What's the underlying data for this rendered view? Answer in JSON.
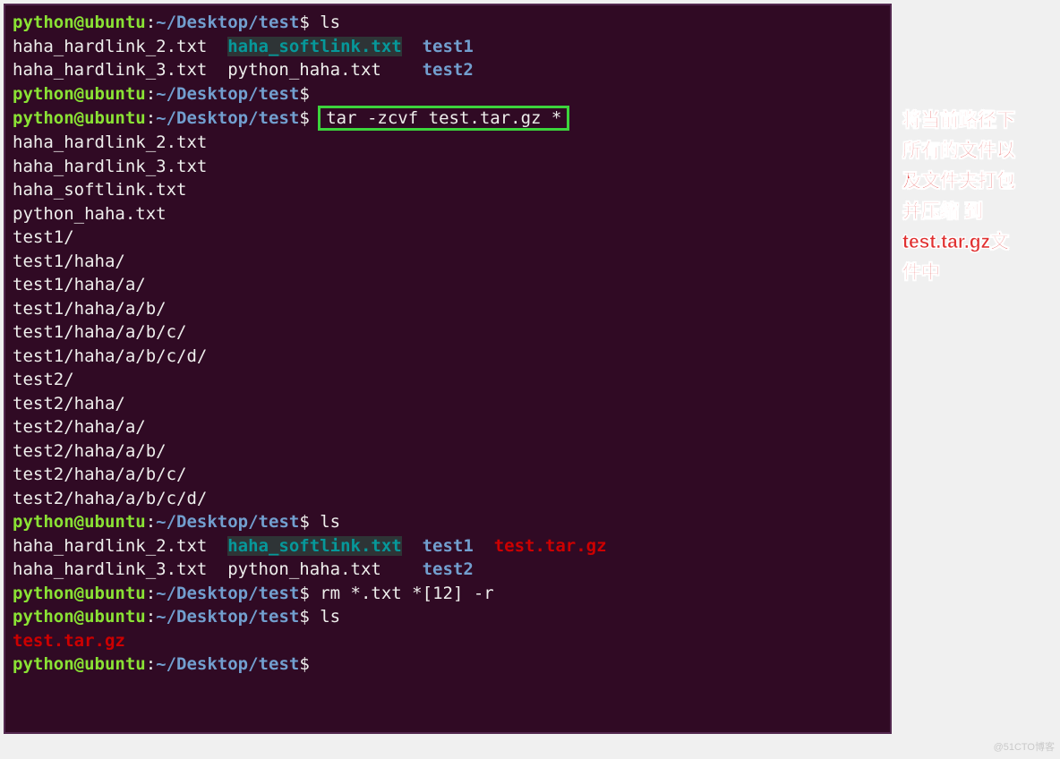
{
  "prompt": {
    "user": "python@ubuntu",
    "sep": ":",
    "path": "~/Desktop/test",
    "dollar": "$"
  },
  "cmd": {
    "ls": "ls",
    "tar": "tar -zcvf test.tar.gz *",
    "rm": "rm *.txt *[12] -r"
  },
  "files": {
    "hardlink2": "haha_hardlink_2.txt",
    "hardlink3": "haha_hardlink_3.txt",
    "softlink": "haha_softlink.txt",
    "pyhaha": "python_haha.txt",
    "test1": "test1",
    "test2": "test2",
    "tgz": "test.tar.gz"
  },
  "tarout": [
    "haha_hardlink_2.txt",
    "haha_hardlink_3.txt",
    "haha_softlink.txt",
    "python_haha.txt",
    "test1/",
    "test1/haha/",
    "test1/haha/a/",
    "test1/haha/a/b/",
    "test1/haha/a/b/c/",
    "test1/haha/a/b/c/d/",
    "test2/",
    "test2/haha/",
    "test2/haha/a/",
    "test2/haha/a/b/",
    "test2/haha/a/b/c/",
    "test2/haha/a/b/c/d/"
  ],
  "annotation": {
    "line1": "将当前路径下",
    "line2": "所有的文件以",
    "line3": "及文件夹打包",
    "line4": "并压缩 到",
    "line5": "test.tar.gz文",
    "line6": "件中"
  },
  "watermark": "@51CTO博客"
}
